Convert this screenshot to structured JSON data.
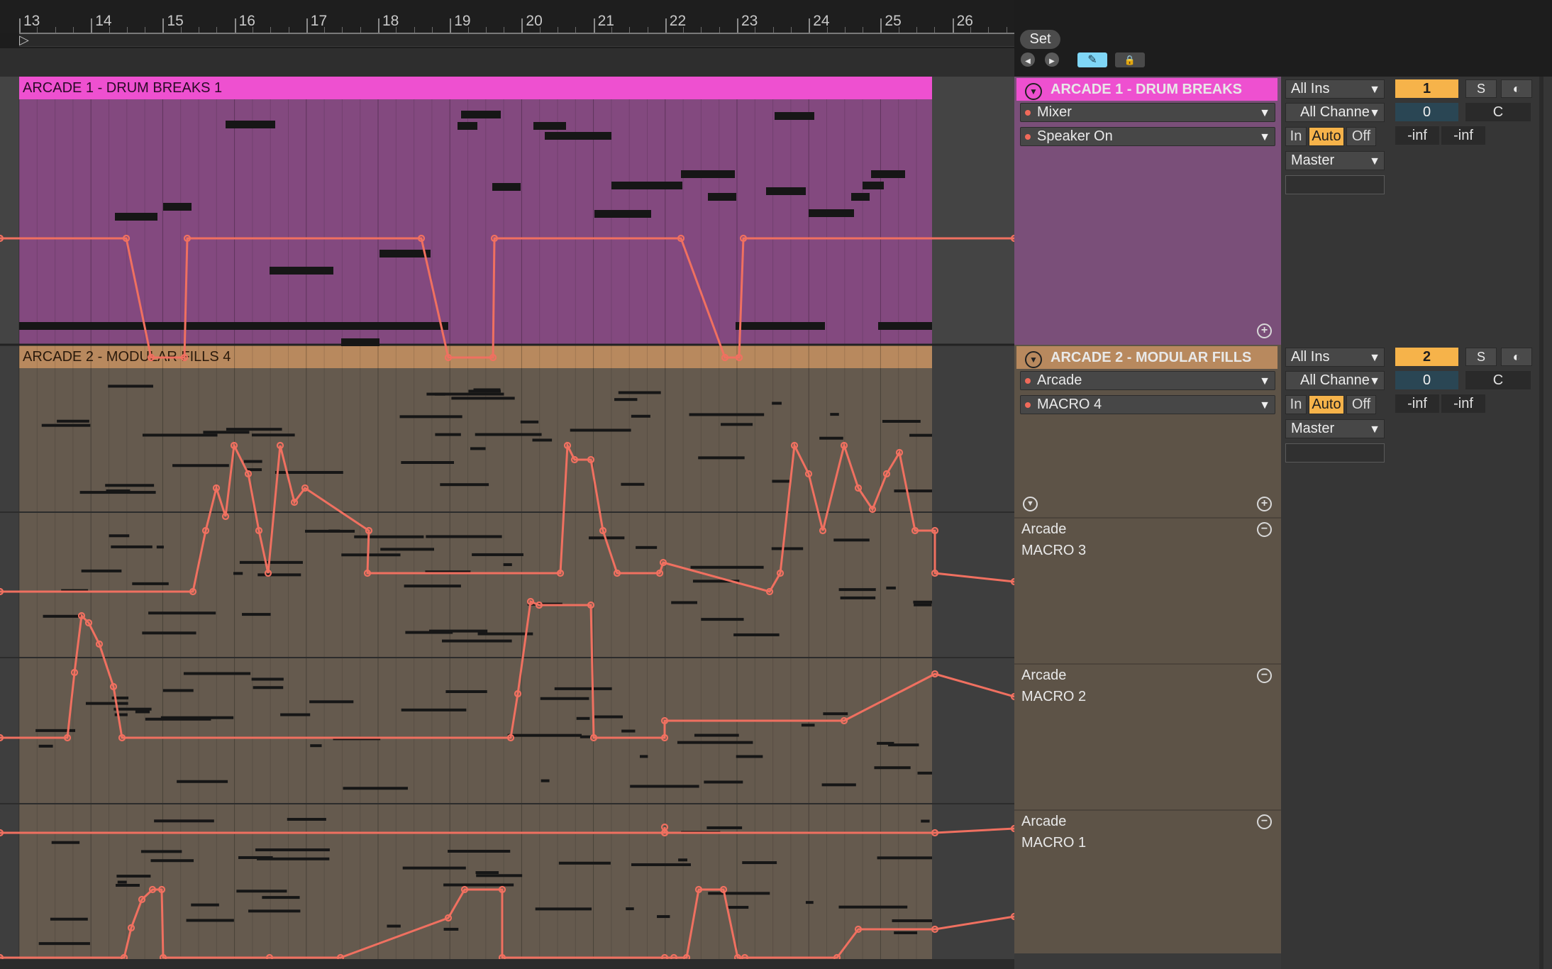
{
  "ruler": {
    "bars": [
      "13",
      "14",
      "15",
      "16",
      "17",
      "18",
      "19",
      "20",
      "21",
      "22",
      "23",
      "24",
      "25",
      "26"
    ],
    "loop_start_glyph": "▷"
  },
  "toolbar": {
    "set_label": "Set",
    "prev_locator_glyph": "◀",
    "next_locator_glyph": "▶",
    "draw_mode_glyph": "✎",
    "lock_glyph": "🔒"
  },
  "tracks": [
    {
      "name": "ARCADE 1 - DRUM BREAKS",
      "clip_name": "ARCADE 1 - DRUM BREAKS 1",
      "color": "#ee50d0",
      "clip_body_color": "#83497f",
      "device_chooser": "Mixer",
      "parameter_chooser": "Speaker On",
      "input_type": "All Ins",
      "input_channel": "All Channels",
      "monitor": [
        "In",
        "Auto",
        "Off"
      ],
      "monitor_active": "Auto",
      "output": "Master",
      "number": "1",
      "solo_label": "S",
      "volume": "0",
      "pan": "C",
      "meter_left": "-inf",
      "meter_right": "-inf"
    },
    {
      "name": "ARCADE 2 - MODULAR FILLS",
      "clip_name": "ARCADE 2 - MODULAR FILLS 4",
      "color": "#b8895e",
      "clip_body_color": "#655a4e",
      "device_chooser": "Arcade",
      "parameter_chooser": "MACRO 4",
      "input_type": "All Ins",
      "input_channel": "All Channels",
      "monitor": [
        "In",
        "Auto",
        "Off"
      ],
      "monitor_active": "Auto",
      "output": "Master",
      "number": "2",
      "solo_label": "S",
      "volume": "0",
      "pan": "C",
      "meter_left": "-inf",
      "meter_right": "-inf",
      "automation_lanes": [
        {
          "device": "Arcade",
          "parameter": "MACRO 3"
        },
        {
          "device": "Arcade",
          "parameter": "MACRO 2"
        },
        {
          "device": "Arcade",
          "parameter": "MACRO 1"
        }
      ]
    }
  ],
  "colors": {
    "automation": "#f07060",
    "note": "#161616",
    "clip_pink": "#ee50d0",
    "clip_tan": "#b8895e",
    "monitor_active": "#f6b34a",
    "draw_mode_active": "#7fd6f6"
  }
}
